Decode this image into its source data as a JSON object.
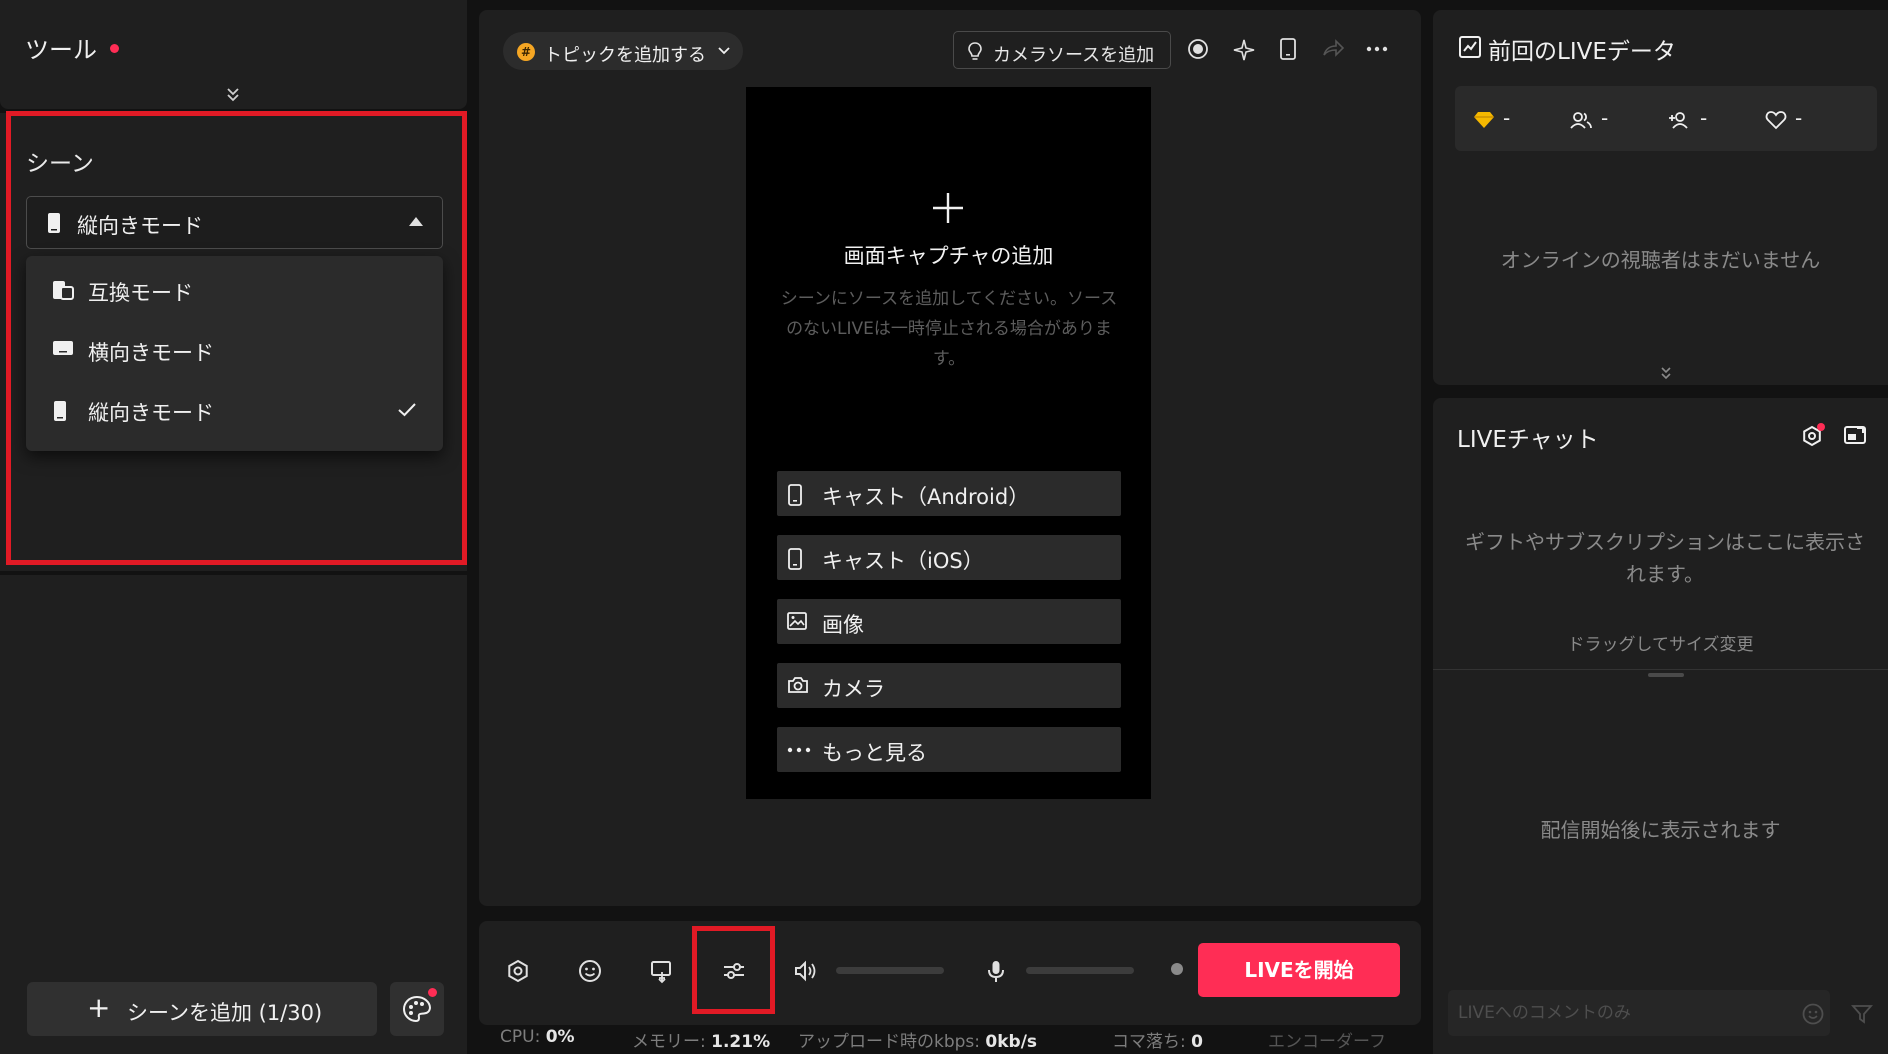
{
  "tools": {
    "title": "ツール"
  },
  "scene": {
    "label": "シーン",
    "selected": "縦向きモード",
    "options": [
      {
        "label": "互換モード",
        "icon": "compat-mode-icon",
        "checked": false
      },
      {
        "label": "横向きモード",
        "icon": "landscape-icon",
        "checked": false
      },
      {
        "label": "縦向きモード",
        "icon": "portrait-icon",
        "checked": true
      }
    ],
    "add_button": "シーンを追加 (1/30)"
  },
  "center": {
    "topic_pill": "トピックを追加する",
    "camera_source": "カメラソースを追加",
    "capture_title": "画面キャプチャの追加",
    "capture_sub": "シーンにソースを追加してください。ソースのないLIVEは一時停止される場合があります。",
    "sources": [
      {
        "label": "キャスト（Android）",
        "icon": "phone-icon"
      },
      {
        "label": "キャスト（iOS）",
        "icon": "phone-icon"
      },
      {
        "label": "画像",
        "icon": "image-icon"
      },
      {
        "label": "カメラ",
        "icon": "camera-icon"
      },
      {
        "label": "もっと見る",
        "icon": "more-icon"
      }
    ],
    "live_button": "LIVEを開始",
    "status": {
      "cpu_label": "CPU:",
      "cpu_value": "0%",
      "memory_label": "メモリー:",
      "memory_value": "1.21%",
      "upload_label": "アップロード時のkbps:",
      "upload_value": "0kb/s",
      "dropped_label": "コマ落ち:",
      "dropped_value": "0",
      "encoder_label": "エンコーダーフ"
    }
  },
  "right": {
    "prev_title": "前回のLIVEデータ",
    "stats": [
      {
        "icon": "diamond-icon",
        "value": "-"
      },
      {
        "icon": "viewers-icon",
        "value": "-"
      },
      {
        "icon": "followers-icon",
        "value": "-"
      },
      {
        "icon": "heart-icon",
        "value": "-"
      }
    ],
    "no_viewers": "オンラインの視聴者はまだいません",
    "chat_title": "LIVEチャット",
    "gift_text": "ギフトやサブスクリプションはここに表示されます。",
    "drag_text": "ドラッグしてサイズ変更",
    "after_start": "配信開始後に表示されます",
    "comment_placeholder": "LIVEへのコメントのみ"
  },
  "colors": {
    "accent": "#ff2d55",
    "highlight_box": "#e11a25",
    "panel": "#1f1f1f",
    "background": "#121212"
  }
}
